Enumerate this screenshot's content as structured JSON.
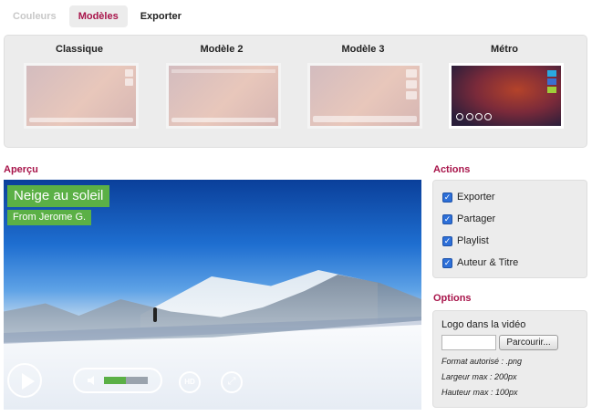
{
  "tabs": [
    {
      "label": "Couleurs"
    },
    {
      "label": "Modèles"
    },
    {
      "label": "Exporter"
    }
  ],
  "templates": [
    {
      "title": "Classique"
    },
    {
      "title": "Modèle 2"
    },
    {
      "title": "Modèle 3"
    },
    {
      "title": "Métro"
    }
  ],
  "preview": {
    "heading": "Aperçu",
    "title": "Neige au soleil",
    "author": "From Jerome G.",
    "hd_label": "HD",
    "volume_level": 0.5
  },
  "actions": {
    "heading": "Actions",
    "items": [
      {
        "label": "Exporter",
        "checked": true
      },
      {
        "label": "Partager",
        "checked": true
      },
      {
        "label": "Playlist",
        "checked": true
      },
      {
        "label": "Auteur & Titre",
        "checked": true
      }
    ]
  },
  "options": {
    "heading": "Options",
    "logo_label": "Logo dans la vidéo",
    "browse_label": "Parcourir...",
    "notes": [
      "Format autorisé : .png",
      "Largeur max : 200px",
      "Hauteur max : 100px"
    ]
  },
  "colors": {
    "accent": "#a8144a",
    "green": "#5bb046",
    "checkbox": "#2d6fd8"
  }
}
